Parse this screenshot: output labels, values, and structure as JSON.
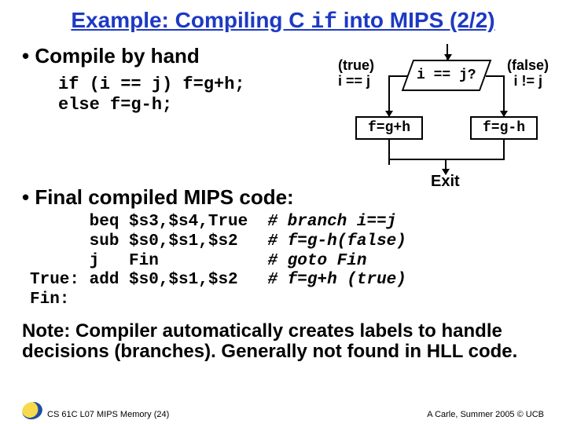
{
  "title_pre": "Example: Compiling C ",
  "title_code": "if",
  "title_post": " into MIPS (2/2)",
  "bullet1": "• Compile by hand",
  "c_code_line1": "if (i == j) f=g+h;",
  "c_code_line2": "else f=g-h;",
  "diagram": {
    "cond": "i == j?",
    "true_top": "(true)",
    "true_bot": "i == j",
    "false_top": "(false)",
    "false_bot": "i != j",
    "box_left": "f=g+h",
    "box_right": "f=g-h",
    "exit": "Exit"
  },
  "bullet2": "• Final compiled MIPS code:",
  "mips": {
    "l1": "      beq $s3,$s4,True  ",
    "c1": "# branch i==j",
    "l2": "      sub $s0,$s1,$s2   ",
    "c2": "# f=g-h(false)",
    "l3": "      j   Fin           ",
    "c3": "# goto Fin",
    "l4": "True: add $s0,$s1,$s2   ",
    "c4": "# f=g+h (true)",
    "l5": "Fin:"
  },
  "note": "Note: Compiler automatically creates labels to handle decisions (branches). Generally not found in HLL code.",
  "footer_left": "CS 61C L07 MIPS Memory (24)",
  "footer_right": "A Carle, Summer 2005 © UCB"
}
